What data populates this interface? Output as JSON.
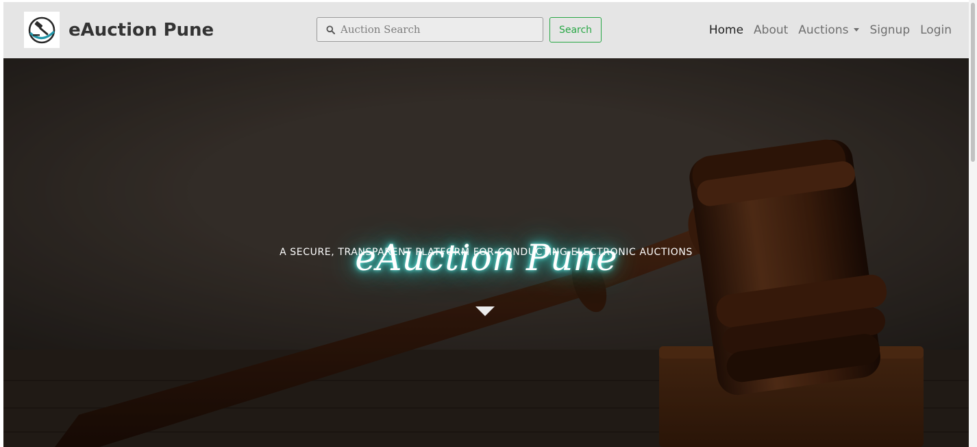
{
  "brand": {
    "name": "eAuction Pune",
    "logo_icon": "gavel-icon"
  },
  "search": {
    "placeholder": "Auction Search",
    "value": "",
    "button_label": "Search",
    "icon": "search-icon"
  },
  "nav": {
    "items": [
      {
        "label": "Home",
        "active": true
      },
      {
        "label": "About",
        "active": false
      },
      {
        "label": "Auctions",
        "active": false,
        "dropdown": true
      },
      {
        "label": "Signup",
        "active": false
      },
      {
        "label": "Login",
        "active": false
      }
    ]
  },
  "hero": {
    "title": "eAuction Pune",
    "subtitle": "A SECURE, TRANSPARENT PLATFORM FOR CONDUCTING ELECTRONIC AUCTIONS",
    "scroll_icon": "caret-down-icon",
    "background": "gavel-photo"
  },
  "colors": {
    "navbar_bg": "#e5e5e5",
    "search_button": "#28a745",
    "title_glow": "#3fd6cf",
    "hero_overlay": "#3e362f"
  }
}
